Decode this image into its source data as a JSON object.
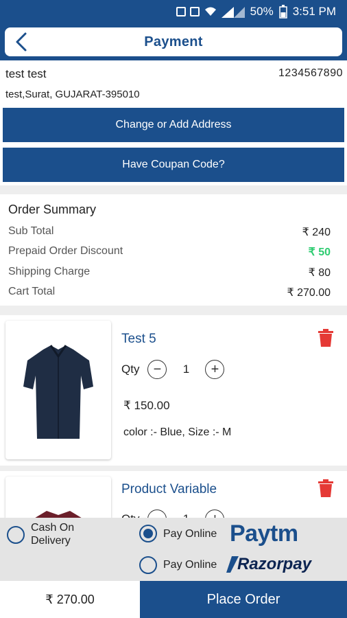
{
  "status_bar": {
    "battery": "50%",
    "time": "3:51 PM"
  },
  "header": {
    "title": "Payment"
  },
  "address": {
    "name": "test test",
    "phone": "1234567890",
    "line": "test,Surat, GUJARAT-395010",
    "change_button": "Change or Add Address",
    "coupon_button": "Have Coupan Code?"
  },
  "summary": {
    "heading": "Order Summary",
    "rows": [
      {
        "label": "Sub Total",
        "value": "₹ 240"
      },
      {
        "label": "Prepaid Order Discount",
        "value": "₹ 50"
      },
      {
        "label": "Shipping Charge",
        "value": "₹ 80"
      },
      {
        "label": "Cart Total",
        "value": "₹ 270.00"
      }
    ],
    "discount_color": "#2ecc71"
  },
  "items": [
    {
      "name": "Test 5",
      "qty_label": "Qty",
      "qty": "1",
      "price": "₹ 150.00",
      "variant": "color :- Blue, Size :- M",
      "shirt_color": "#1f2d44"
    },
    {
      "name": "Product Variable",
      "qty_label": "Qty",
      "qty": "1",
      "shirt_color": "#6b1f2a"
    }
  ],
  "payment": {
    "cod_label": "Cash On\nDelivery",
    "online_label": "Pay Online",
    "paytm_text": "Paytm",
    "razorpay_text": "Razorpay",
    "selected": "paytm"
  },
  "footer": {
    "total": "₹ 270.00",
    "place_order": "Place Order"
  },
  "colors": {
    "primary": "#1b4f8c",
    "danger": "#e53935"
  }
}
